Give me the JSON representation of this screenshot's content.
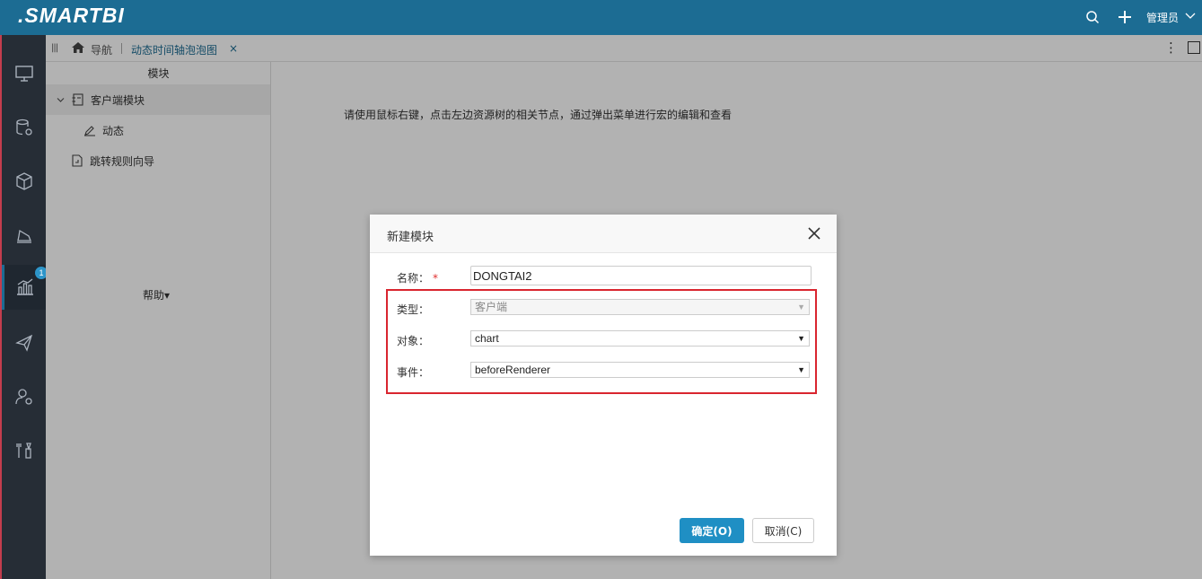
{
  "app": {
    "logo": ".SMARTBI",
    "user": "管理员"
  },
  "tabs": {
    "nav_label": "导航",
    "active_tab": "动态时间轴泡泡图",
    "close_glyph": "×",
    "more_glyph": "⋮"
  },
  "rail": {
    "items": [
      "monitor-icon",
      "database-settings-icon",
      "cube-icon",
      "analysis-icon",
      "report-chart-icon",
      "send-icon",
      "user-settings-icon",
      "tools-icon"
    ],
    "badge": "1"
  },
  "tree": {
    "header": "模块",
    "items": [
      {
        "label": "客户端模块",
        "icon": "module-icon"
      },
      {
        "label": "动态",
        "icon": "edit-icon"
      },
      {
        "label": "跳转规则向导",
        "icon": "jump-rule-icon"
      }
    ],
    "help": "帮助▾"
  },
  "main": {
    "hint": "请使用鼠标右键，点击左边资源树的相关节点，通过弹出菜单进行宏的编辑和查看"
  },
  "dialog": {
    "title": "新建模块",
    "name_label": "名称：",
    "name_required": "*",
    "name_value": "DONGTAI2",
    "type_label": "类型：",
    "type_value": "客户端",
    "object_label": "对象：",
    "object_value": "chart",
    "event_label": "事件：",
    "event_value": "beforeRenderer",
    "ok_label": "确定(O)",
    "cancel_label": "取消(C)"
  },
  "colors": {
    "topbar": "#1c6c93",
    "rail": "#262d36",
    "primary_button": "#1f8fc4",
    "highlight": "#d9252f"
  }
}
